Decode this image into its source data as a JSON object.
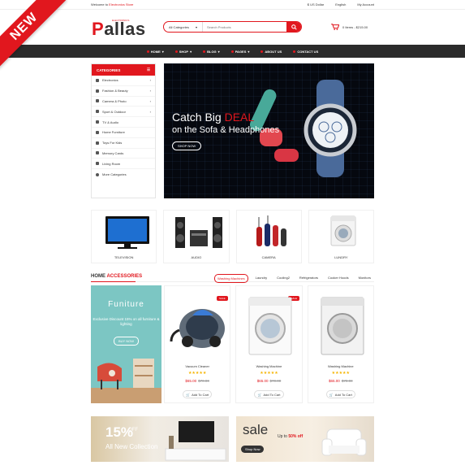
{
  "ribbon": "NEW",
  "topbar": {
    "welcome": "Welcome to",
    "shop_name": "Electronics Store",
    "currency": "$ US Dollar",
    "language": "English",
    "account": "My Account"
  },
  "header": {
    "logo_first": "P",
    "logo_rest": "allas",
    "logo_sub": "ELECTRONICS",
    "search_category": "All Categories",
    "search_placeholder": "Search Products",
    "cart_text": "0 Items - $215.00"
  },
  "nav": [
    "HOME",
    "SHOP",
    "BLOG",
    "PAGES",
    "ABOUT US",
    "CONTACT US"
  ],
  "sidebar": {
    "title": "CATEGORIES",
    "items": [
      {
        "label": "Electronics",
        "arrow": true
      },
      {
        "label": "Fashion & Beauty",
        "arrow": true
      },
      {
        "label": "Camera & Photo",
        "arrow": true
      },
      {
        "label": "Sport & Outdoor",
        "arrow": true
      },
      {
        "label": "TV & Audio",
        "arrow": false
      },
      {
        "label": "Home Furniture",
        "arrow": false
      },
      {
        "label": "Toys For Kids",
        "arrow": false
      },
      {
        "label": "Memory Cards",
        "arrow": false
      },
      {
        "label": "Living Room",
        "arrow": false
      },
      {
        "label": "More Categories",
        "arrow": false
      }
    ]
  },
  "banner": {
    "line1_pre": "Catch Big ",
    "line1_hl": "DEAL",
    "line2": "on the Sofa & Headphones",
    "button": "SHOP NOW"
  },
  "category_cards": [
    "TELEVISION",
    "AUDIO",
    "CAMERA",
    "LUNDRY"
  ],
  "section": {
    "title_pre": "HOME ",
    "title_hl": "ACCESSORIES",
    "tabs": [
      "Washing Machines",
      "Laundry",
      "Cooling2",
      "Refrigerators",
      "Cooker Hoods",
      "Monitors"
    ]
  },
  "promo": {
    "title": "Funiture",
    "desc": "Exclusive Discount 15% on all furniture & lighting",
    "button": "BUY NOW"
  },
  "products": [
    {
      "name": "Vacuum Cleaner",
      "badge": "SALE",
      "price": "$65.00",
      "old": "$70.00",
      "cart": "Add To Cart"
    },
    {
      "name": "Washing Machine",
      "badge": "SALE",
      "price": "$65.00",
      "old": "$70.00",
      "cart": "Add To Cart"
    },
    {
      "name": "Washing Machine",
      "badge": "",
      "price": "$65.00",
      "old": "$70.00",
      "cart": "Add To Cart"
    }
  ],
  "bottom": {
    "b1_pct": "15%",
    "b1_off": "OFF",
    "b1_col": "All New Collection",
    "b2_sale": "sale",
    "b2_upto": "Up to ",
    "b2_pct": "50% off",
    "b2_btn": "Shop Now"
  },
  "colors": {
    "accent": "#e1171e",
    "nav_bg": "#2b2b2b",
    "promo_bg": "#7cc6c3"
  }
}
